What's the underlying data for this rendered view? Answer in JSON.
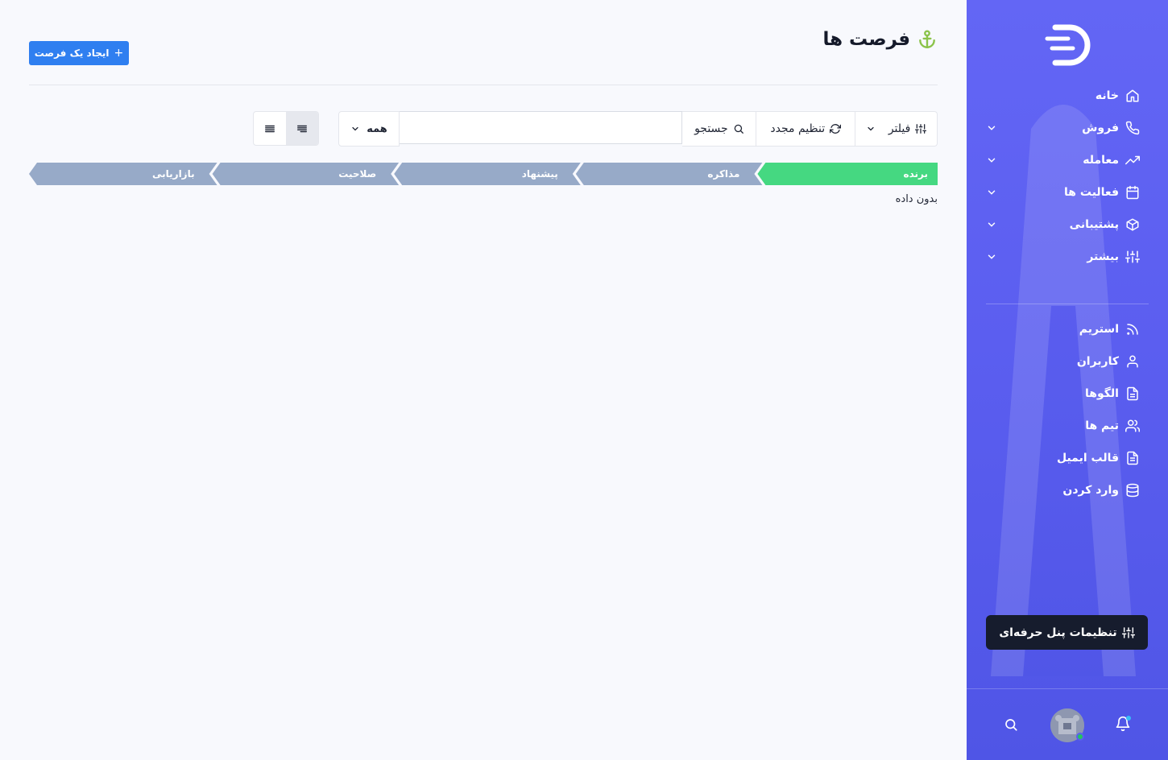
{
  "page": {
    "title": "فرصت ها",
    "create_button": "ایجاد یک فرصت",
    "empty_text": "بدون داده"
  },
  "toolbar": {
    "filter_label": "فیلتر",
    "reset_label": "تنظیم مجدد",
    "search_label": "جستجو",
    "search_value": "",
    "select_value": "همه"
  },
  "pipeline": {
    "stages": [
      "برنده",
      "مذاکره",
      "پیشنهاد",
      "صلاحیت",
      "بازاریابی"
    ],
    "active_index": 0,
    "active_color": "#45d881",
    "inactive_color": "#97aac8"
  },
  "sidebar": {
    "items": [
      {
        "label": "خانه",
        "icon": "home-icon"
      },
      {
        "label": "فروش",
        "icon": "phone-icon"
      },
      {
        "label": "معامله",
        "icon": "trending-up-icon"
      },
      {
        "label": "فعالیت ها",
        "icon": "calendar-icon"
      },
      {
        "label": "پشتیبانی",
        "icon": "box-icon"
      },
      {
        "label": "بیشتر",
        "icon": "sliders-icon"
      }
    ],
    "items2": [
      {
        "label": "استریم",
        "icon": "rss-icon"
      },
      {
        "label": "کاربران",
        "icon": "user-icon"
      },
      {
        "label": "الگوها",
        "icon": "file-icon"
      },
      {
        "label": "تیم ها",
        "icon": "users-icon"
      },
      {
        "label": "قالب ایمیل",
        "icon": "file-text-icon"
      },
      {
        "label": "وارد کردن",
        "icon": "database-icon"
      }
    ],
    "pro_button": "تنظیمات پنل حرفه‌ای"
  },
  "colors": {
    "sidebar": "#5b5ef0",
    "primary_button": "#2f7ff0",
    "title_icon": "#8bc34a"
  }
}
